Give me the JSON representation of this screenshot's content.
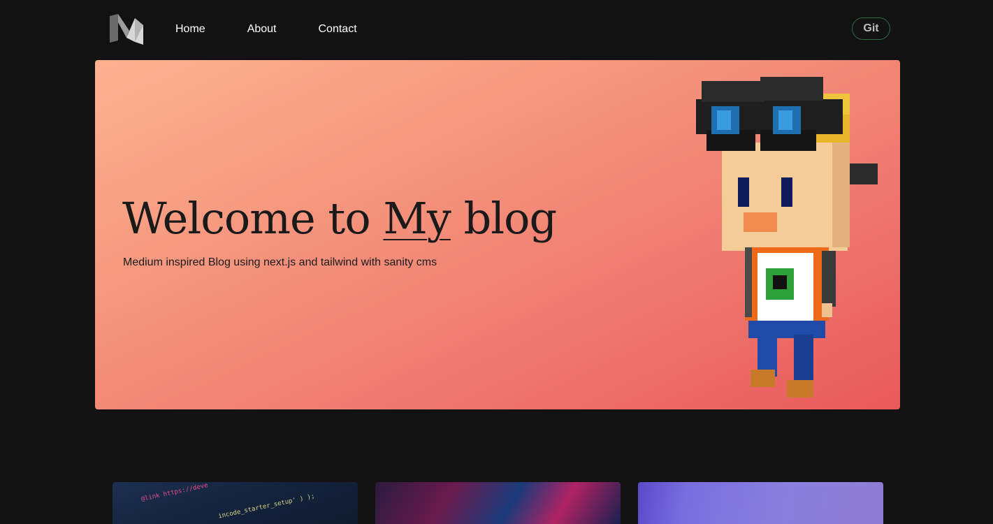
{
  "header": {
    "logo_icon": "medium-m-logo-icon",
    "nav": [
      {
        "label": "Home"
      },
      {
        "label": "About"
      },
      {
        "label": "Contact"
      }
    ],
    "git_button": "Git"
  },
  "hero": {
    "title_prefix": "Welcome to ",
    "title_underlined": "My",
    "title_suffix": " blog",
    "subtitle": "Medium inspired Blog using next.js and tailwind with sanity cms",
    "illustration_icon": "voxel-character-illustration",
    "gradient_colors": [
      "#fdb191",
      "#e9595c"
    ]
  },
  "cards": [
    {
      "image_icon": "code-screenshot-image",
      "code_line_1": "@link https://deve",
      "code_line_2": "incode_starter_setup' ) );"
    },
    {
      "image_icon": "abstract-neon-art-image"
    },
    {
      "image_icon": "purple-gradient-image"
    }
  ],
  "colors": {
    "background": "#121212",
    "git_border": "#2e6b46",
    "text_dark": "#1a1a1a"
  }
}
